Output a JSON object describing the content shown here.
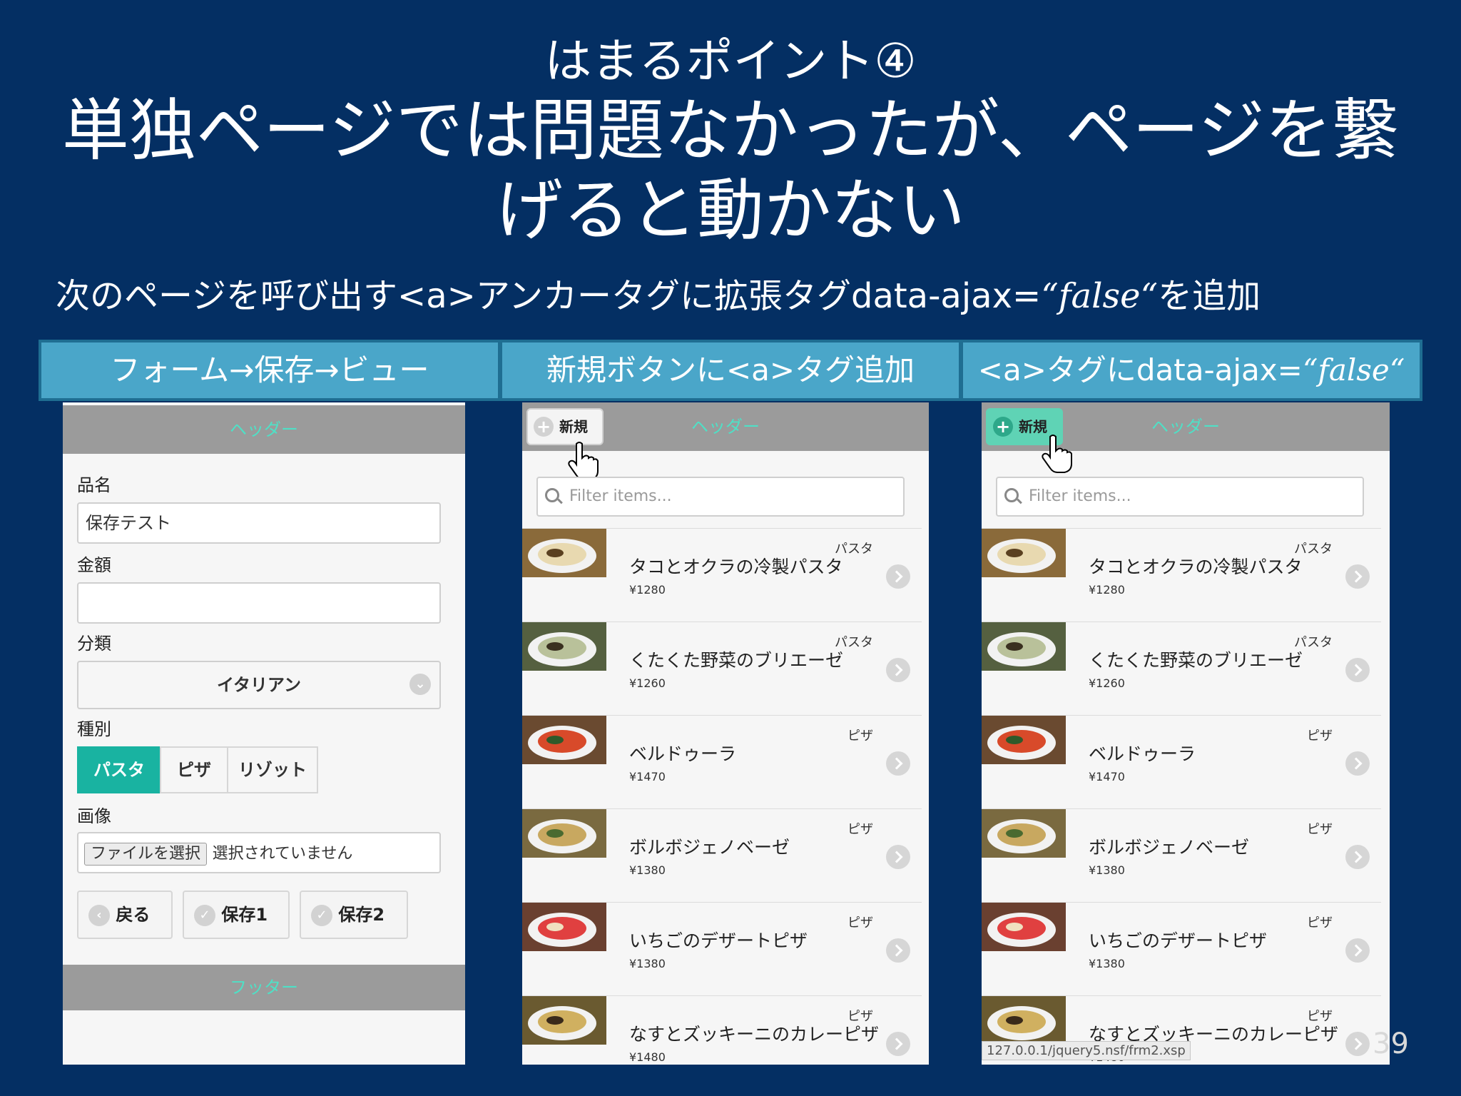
{
  "slide": {
    "title_line1": "はまるポイント④",
    "title_line2a": "単独ページでは問題なかったが、ページを繋",
    "title_line2b": "げると動かない",
    "subtitle_prefix": "次のページを呼び出す<a>アンカータグに拡張タグdata-ajax=",
    "subtitle_italic": "“false“",
    "subtitle_suffix": "を追加",
    "page_number": "39"
  },
  "columns": {
    "col1": "フォーム→保存→ビュー",
    "col2": "新規ボタンに<a>タグ追加",
    "col3_prefix": "<a>タグにdata-ajax=",
    "col3_italic": "“false“"
  },
  "form_screen": {
    "header": "ヘッダー",
    "label_name": "品名",
    "value_name": "保存テスト",
    "label_price": "金額",
    "value_price": "",
    "label_category": "分類",
    "select_category": "イタリアン",
    "label_type": "種別",
    "type_options": [
      "パスタ",
      "ピザ",
      "リゾット"
    ],
    "type_selected": "パスタ",
    "label_image": "画像",
    "file_button": "ファイルを選択",
    "file_status": "選択されていません",
    "btn_back": "戻る",
    "btn_save1": "保存1",
    "btn_save2": "保存2",
    "footer": "フッター"
  },
  "list_screen": {
    "header": "ヘッダー",
    "new_button": "新規",
    "filter_placeholder": "Filter items...",
    "url": "127.0.0.1/jquery5.nsf/frm2.xsp",
    "items": [
      {
        "name": "タコとオクラの冷製パスタ",
        "price": "¥1280",
        "category": "パスタ"
      },
      {
        "name": "くたくた野菜のブリエーゼ",
        "price": "¥1260",
        "category": "パスタ"
      },
      {
        "name": "ベルドゥーラ",
        "price": "¥1470",
        "category": "ピザ"
      },
      {
        "name": "ボルボジェノベーゼ",
        "price": "¥1380",
        "category": "ピザ"
      },
      {
        "name": "いちごのデザートピザ",
        "price": "¥1380",
        "category": "ピザ"
      },
      {
        "name": "なすとズッキーニのカレーピザ",
        "price": "¥1480",
        "category": "ピザ"
      }
    ]
  },
  "colors": {
    "background": "#042f63",
    "header_teal": "#4aa6c9",
    "jq_header": "#9b9b9b",
    "jq_header_text": "#4fe0c6",
    "active_segment": "#19b3a1",
    "new_btn_active": "#5fd3b5"
  }
}
